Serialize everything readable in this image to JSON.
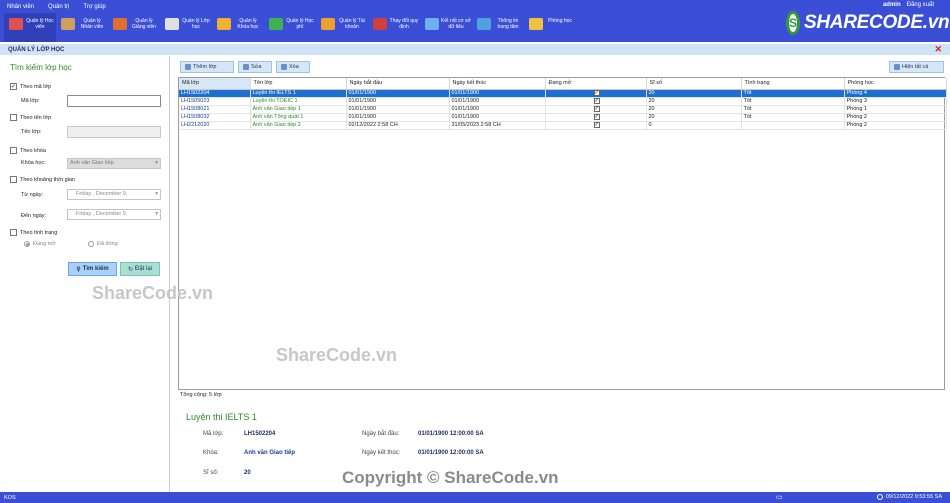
{
  "menu": {
    "items": [
      "Nhân viên",
      "Quản trị",
      "Trợ giúp"
    ],
    "user": "admin",
    "logout": "Đăng xuất"
  },
  "ribbon": [
    {
      "label": "Quản lý Học viên",
      "icon": "student-icon",
      "color": "#e05050"
    },
    {
      "label": "Quản lý Nhân viên",
      "icon": "staff-icon",
      "color": "#d0a060"
    },
    {
      "label": "Quản lý Giảng viên",
      "icon": "teacher-icon",
      "color": "#e07030"
    },
    {
      "label": "Quản lý Lớp học",
      "icon": "classroom-icon",
      "color": "#e0e0e0"
    },
    {
      "label": "Quản lý Khóa học",
      "icon": "course-icon",
      "color": "#f0b030"
    },
    {
      "label": "Quản lý Học phí",
      "icon": "tuition-icon",
      "color": "#40b050"
    },
    {
      "label": "Quản lý Tài khoản",
      "icon": "account-icon",
      "color": "#f0a030"
    },
    {
      "label": "Thay đổi quy định",
      "icon": "rules-icon",
      "color": "#d04040"
    },
    {
      "label": "Kết nối cơ sở dữ liệu",
      "icon": "database-icon",
      "color": "#6fb0f0"
    },
    {
      "label": "Thông tin trung tâm",
      "icon": "info-icon",
      "color": "#50a0e0"
    },
    {
      "label": "Phòng học",
      "icon": "room-icon",
      "color": "#f0c040"
    }
  ],
  "logo": {
    "text": "SHARECODE.vn",
    "glyph": "S"
  },
  "title": {
    "text": "QUẢN LÝ LỚP HỌC",
    "close": "✕"
  },
  "search": {
    "header": "Tìm kiếm lớp học",
    "by_code": {
      "label": "Theo mã lớp",
      "field_label": "Mã lớp:",
      "value": "",
      "checked": "✓"
    },
    "by_name": {
      "label": "Theo tên lớp",
      "field_label": "Tên lớp:"
    },
    "by_course": {
      "label": "Theo khóa",
      "field_label": "Khóa học:",
      "selected": "Anh văn Giao tiếp",
      "arrow": "▾"
    },
    "by_time": {
      "label": "Theo khoảng thời gian",
      "from_label": "Từ ngày:",
      "to_label": "Đến ngày:",
      "from_value": "Friday   ,  December   9,",
      "to_value": "Friday   ,  December   9,",
      "arrow": "▾"
    },
    "by_status": {
      "label": "Theo tình trạng",
      "opt_open": "Đang mở",
      "opt_closed": "Đã đóng"
    },
    "search_button": "Tìm kiếm",
    "reset_button": "Đặt lại"
  },
  "toolbar": {
    "add": "Thêm lớp",
    "edit": "Sửa",
    "delete": "Xóa",
    "show_all": "Hiện tất cả"
  },
  "table": {
    "columns": [
      "Mã lớp",
      "Tên lớp",
      "Ngày bắt đầu",
      "Ngày kết thúc",
      "Đang mở",
      "Sĩ số",
      "Tình trạng",
      "Phòng học"
    ],
    "rows": [
      {
        "code": "LH1502204",
        "name": "Luyện thi IELTS 1",
        "start": "01/01/1900",
        "end": "01/01/1900",
        "open": "✓",
        "size": "20",
        "status": "Tốt",
        "room": "Phòng 4",
        "name_color": "blue"
      },
      {
        "code": "LH1505023",
        "name": "Luyện thi TOEIC 1",
        "start": "01/01/1900",
        "end": "01/01/1900",
        "open": "✓",
        "size": "20",
        "status": "Tốt",
        "room": "Phòng 3",
        "name_color": "green"
      },
      {
        "code": "LH1508021",
        "name": "Anh văn Giao tiếp 1",
        "start": "01/01/1900",
        "end": "01/01/1900",
        "open": "✓",
        "size": "20",
        "status": "Tốt",
        "room": "Phòng 1",
        "name_color": "green"
      },
      {
        "code": "LH1508032",
        "name": "Anh văn Tổng quát 1",
        "start": "01/01/1900",
        "end": "01/01/1900",
        "open": "✓",
        "size": "20",
        "status": "Tốt",
        "room": "Phòng 2",
        "name_color": "green"
      },
      {
        "code": "LH2212020",
        "name": "Anh văn Giao tiếp 2",
        "start": "02/12/2022 2:58 CH",
        "end": "31/05/2023 2:58 CH",
        "open": "✓",
        "size": "0",
        "status": "",
        "room": "Phòng 2",
        "name_color": "green"
      }
    ],
    "total": "Tổng cộng: 5 lớp"
  },
  "detail": {
    "title": "Luyện thi IELTS 1",
    "code_label": "Mã lớp:",
    "code": "LH1502204",
    "course_label": "Khóa:",
    "course": "Anh văn Giao tiếp",
    "size_label": "Sĩ số:",
    "size": "20",
    "start_label": "Ngày bắt đầu:",
    "start": "01/01/1900 12:00:00 SA",
    "end_label": "Ngày kết thúc:",
    "end": "01/01/1900 12:00:00 SA"
  },
  "watermarks": {
    "w1": "ShareCode.vn",
    "w2": "ShareCode.vn",
    "copyright": "Copyright © ShareCode.vn"
  },
  "status": {
    "left": "KOS",
    "datetime": "09/12/2022 9:53:55 SA"
  }
}
